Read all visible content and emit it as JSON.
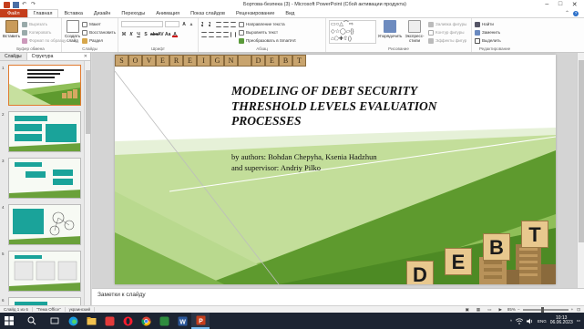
{
  "window": {
    "title": "Бортова-безпека (3) - Microsoft PowerPoint (Сбой активации продукта)",
    "controls": [
      "–",
      "□",
      "✕"
    ]
  },
  "ribbon_tabs": [
    "Файл",
    "Главная",
    "Вставка",
    "Дизайн",
    "Переходы",
    "Анимация",
    "Показ слайдов",
    "Рецензирование",
    "Вид"
  ],
  "ribbon": {
    "clipboard": {
      "paste": "Вставить",
      "cut": "Вырезать",
      "copy": "Копировать",
      "format_painter": "Формат по образцу",
      "label": "Буфер обмена"
    },
    "slides": {
      "new_slide": "Создать слайд",
      "layout": "Макет",
      "reset": "Восстановить",
      "section": "Раздел",
      "label": "Слайды"
    },
    "font": {
      "label": "Шрифт"
    },
    "paragraph": {
      "text_direction": "Направление текста",
      "align_text": "Выровнять текст",
      "convert_smartart": "Преобразовать в SmartArt",
      "label": "Абзац"
    },
    "drawing": {
      "arrange": "Упорядочить",
      "quick_styles": "Экспресс-стили",
      "shape_fill": "Заливка фигуры",
      "shape_outline": "Контур фигуры",
      "shape_effects": "Эффекты фигур",
      "label": "Рисование"
    },
    "editing": {
      "find": "Найти",
      "replace": "Заменить",
      "select": "Выделить",
      "label": "Редактирование"
    }
  },
  "left_panel": {
    "tabs": [
      "Слайды",
      "Структура"
    ],
    "close": "✕",
    "slide_numbers": [
      "1",
      "2",
      "3",
      "4",
      "5",
      "6"
    ]
  },
  "slide": {
    "banner_letters": [
      "S",
      "O",
      "V",
      "E",
      "R",
      "E",
      "I",
      "G",
      "N",
      "",
      "D",
      "E",
      "B",
      "T"
    ],
    "title": "MODELING OF DEBT SECURITY THRESHOLD LEVELS EVALUATION PROCESSES",
    "subtitle_line1": "by authors: Bohdan Chepyha, Ksenia Hadzhun",
    "subtitle_line2": "and supervisor: Andriy Pilko",
    "debt_letters": [
      "D",
      "E",
      "B",
      "T"
    ]
  },
  "notes": {
    "placeholder": "Заметки к слайду"
  },
  "status_bar": {
    "slide_info": "Слайд 1 из 6",
    "theme": "\"Тема Office\"",
    "language": "украинский",
    "zoom": "85%"
  },
  "taskbar": {
    "time": "10:13",
    "date": "06.06.2023",
    "lang": "ENG",
    "tray_chevron": "^"
  },
  "colors": {
    "file_tab": "#c43e1c",
    "slide_green": "#6aa13a",
    "taskbar": "#1c2432"
  }
}
